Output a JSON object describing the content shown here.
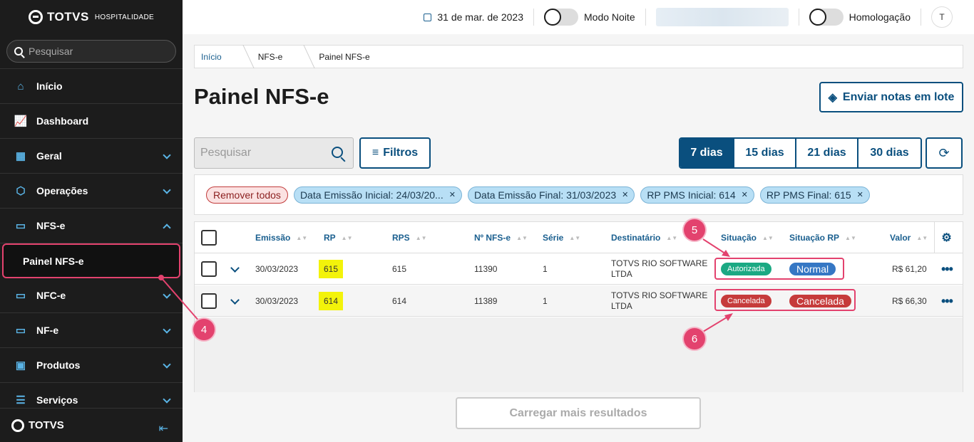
{
  "sidebar": {
    "logo_brand": "TOTVS",
    "logo_sub": "HOSPITALIDADE",
    "search_placeholder": "Pesquisar",
    "items": [
      {
        "label": "Início"
      },
      {
        "label": "Dashboard"
      },
      {
        "label": "Geral"
      },
      {
        "label": "Operações"
      },
      {
        "label": "NFS-e"
      },
      {
        "label": "Painel NFS-e"
      },
      {
        "label": "NFC-e"
      },
      {
        "label": "NF-e"
      },
      {
        "label": "Produtos"
      },
      {
        "label": "Serviços"
      }
    ],
    "footer_brand": "TOTVS"
  },
  "topbar": {
    "date": "31 de mar. de 2023",
    "night_mode": "Modo Noite",
    "homologation": "Homologação",
    "avatar": "T"
  },
  "breadcrumb": [
    "Início",
    "NFS-e",
    "Painel NFS-e"
  ],
  "page_title": "Painel NFS-e",
  "send_batch": "Enviar notas em lote",
  "search_placeholder": "Pesquisar",
  "filters": "Filtros",
  "days": [
    "7 dias",
    "15 dias",
    "21 dias",
    "30 dias"
  ],
  "chips": {
    "remove_all": "Remover todos",
    "items": [
      "Data Emissão Inicial: 24/03/20...",
      "Data Emissão Final: 31/03/2023",
      "RP PMS Inicial: 614",
      "RP PMS Final: 615"
    ]
  },
  "table": {
    "headers": [
      "Emissão",
      "RP",
      "RPS",
      "Nº NFS-e",
      "Série",
      "Destinatário",
      "Situação",
      "Situação RP",
      "Valor"
    ],
    "rows": [
      {
        "emissao": "30/03/2023",
        "rp": "615",
        "rps": "615",
        "nfse": "11390",
        "serie": "1",
        "dest": "TOTVS RIO SOFTWARE LTDA",
        "situacao": "Autorizada",
        "situacao_rp": "Normal",
        "valor": "R$ 61,20"
      },
      {
        "emissao": "30/03/2023",
        "rp": "614",
        "rps": "614",
        "nfse": "11389",
        "serie": "1",
        "dest": "TOTVS RIO SOFTWARE LTDA",
        "situacao": "Cancelada",
        "situacao_rp": "Cancelada",
        "valor": "R$ 66,30"
      }
    ]
  },
  "load_more": "Carregar mais resultados",
  "annotations": [
    "4",
    "5",
    "6"
  ],
  "colors": {
    "accent": "#0a4f7e",
    "annotation": "#e3426e",
    "highlight": "#f3f30a"
  }
}
